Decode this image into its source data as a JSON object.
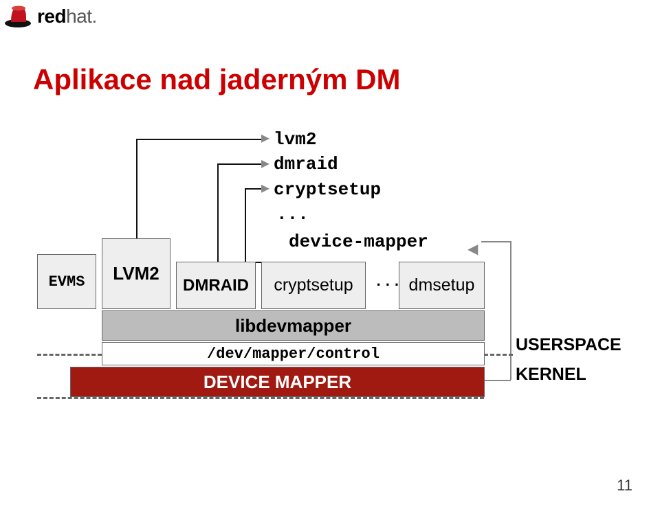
{
  "brand": {
    "bold": "red",
    "light": "hat."
  },
  "title": "Aplikace nad jaderným DM",
  "page_number": "11",
  "commands": {
    "lvm2": "lvm2",
    "dmraid": "dmraid",
    "cryptsetup": "cryptsetup",
    "dots": "...",
    "device_mapper": "device-mapper"
  },
  "boxes": {
    "evms": "EVMS",
    "lvm2": "LVM2",
    "dmraid": "DMRAID",
    "cryptsetup": "cryptsetup",
    "row_dots": "...",
    "dmsetup": "dmsetup",
    "libdevmapper": "libdevmapper",
    "dev_control": "/dev/mapper/control",
    "device_mapper": "DEVICE MAPPER"
  },
  "side": {
    "userspace": "USERSPACE",
    "kernel": "KERNEL"
  }
}
